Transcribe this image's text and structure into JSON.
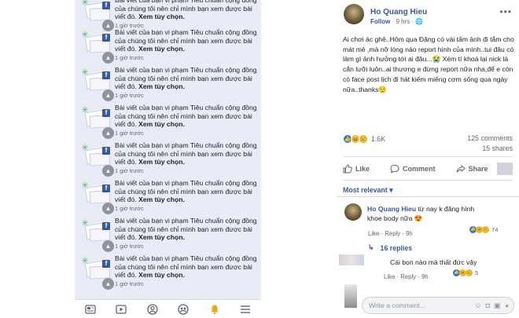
{
  "notifications": {
    "text_prefix": "Bài viết của bạn vi phạm Tiêu chuẩn cộng đồng của chúng tôi nên chỉ mình bạn xem được bài viết đó. ",
    "text_action": "Xem tùy chọn.",
    "time": "1 giờ trước",
    "fb_glyph": "f",
    "items": [
      {
        "id": 1
      },
      {
        "id": 2
      },
      {
        "id": 3
      },
      {
        "id": 4
      },
      {
        "id": 5
      },
      {
        "id": 6
      },
      {
        "id": 7
      },
      {
        "id": 8
      }
    ]
  },
  "bottom_nav": [
    {
      "icon": "news-feed-icon"
    },
    {
      "icon": "watch-icon"
    },
    {
      "icon": "profile-icon"
    },
    {
      "icon": "groups-icon"
    },
    {
      "icon": "notifications-bell-icon"
    },
    {
      "icon": "menu-icon"
    }
  ],
  "post": {
    "author": "Ho Quang Hieu",
    "follow": "Follow",
    "time": "· 9 hrs ·",
    "text": "Ai chơi ác ghê..Hôm qua Đăng có vài tấm ảnh đi tắm cho mát mẻ ,mà nỡ lòng nào report hình của mình..tui đâu có làm gì ảnh hưởng tới ai đâu...😭 Xém tí khoá lại nick là cắn lưỡi luôn..ai thương e đừng report nữa nha,để e còn có face post lịch đi hát kiếm miếng cơm sống qua ngày nữa..thanks😌",
    "reaction_count": "1.6K",
    "comments_count": "125 comments",
    "shares_count": "15 shares",
    "actions": {
      "like": "Like",
      "comment": "Comment",
      "share": "Share"
    }
  },
  "comments": {
    "sort_label": "Most relevant ▾",
    "c1": {
      "name": "Ho Quang Hieu",
      "text": " từ nay k đăng hình khoe body nữa 😍",
      "actions": "Like · Reply · 9h",
      "reaction_count": "74",
      "replies": "16 replies"
    },
    "c2": {
      "text": "Cái bọn nào mà thất đức vậy",
      "actions": "Like · Reply · 9h",
      "reaction_count": "5"
    },
    "write_placeholder": "Write a comment..."
  },
  "colors": {
    "link_blue": "#385898",
    "notif_bg": "#e9ecf7",
    "like_blue": "#2078f4",
    "haha_yellow": "#f7b125"
  }
}
